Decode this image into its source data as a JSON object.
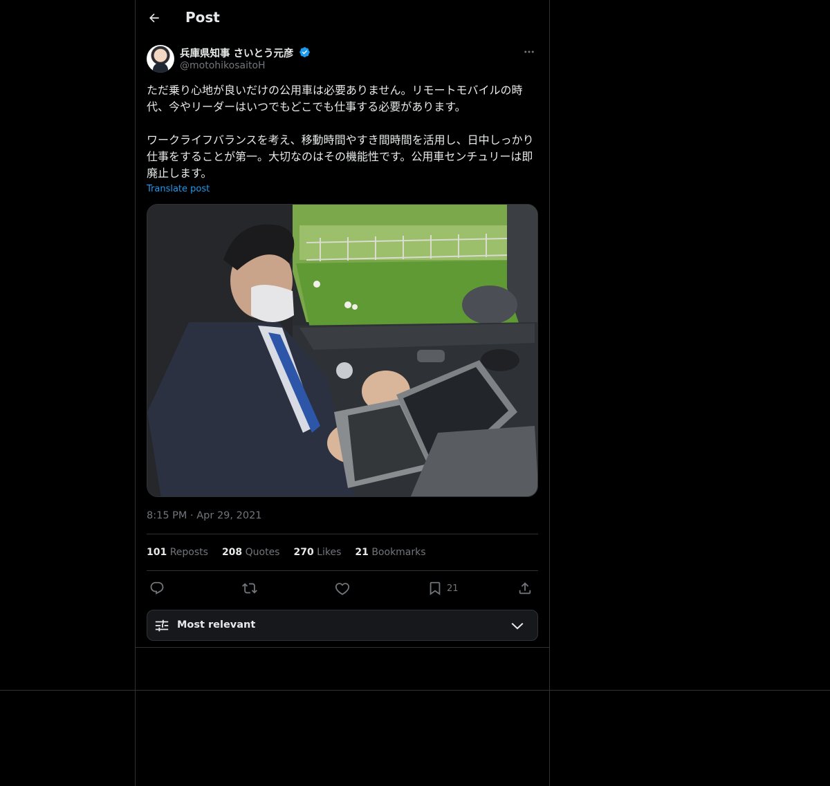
{
  "header": {
    "title": "Post"
  },
  "author": {
    "name": "兵庫県知事 さいとう元彦",
    "handle": "@motohikosaitoH",
    "verified": true
  },
  "post": {
    "text": "ただ乗り心地が良いだけの公用車は必要ありません。リモートモバイルの時代、今やリーダーはいつでもどこでも仕事する必要があります。\n\nワークライフバランスを考え、移動時間やすき間時間を活用し、日中しっかり仕事をすることが第一。大切なのはその機能性です。公用車センチュリーは即廃止します。",
    "translate_label": "Translate post",
    "timestamp": "8:15 PM · Apr 29, 2021"
  },
  "stats": {
    "reposts_count": "101",
    "reposts_label": "Reposts",
    "quotes_count": "208",
    "quotes_label": "Quotes",
    "likes_count": "270",
    "likes_label": "Likes",
    "bookmarks_count": "21",
    "bookmarks_label": "Bookmarks"
  },
  "actions": {
    "bookmark_count": "21"
  },
  "replies": {
    "sort_label": "Most relevant"
  },
  "colors": {
    "background": "#000000",
    "text": "#e7e9ea",
    "muted": "#71767b",
    "border": "#2f3336",
    "link": "#1d9bf0",
    "verified": "#1d9bf0"
  },
  "icons": {
    "back": "arrow-left-icon",
    "more": "more-horizontal-icon",
    "verified": "verified-badge-icon",
    "reply": "reply-icon",
    "repost": "repost-icon",
    "like": "heart-icon",
    "bookmark": "bookmark-icon",
    "share": "share-icon",
    "sort": "sliders-icon",
    "dropdown": "chevron-down-icon"
  }
}
